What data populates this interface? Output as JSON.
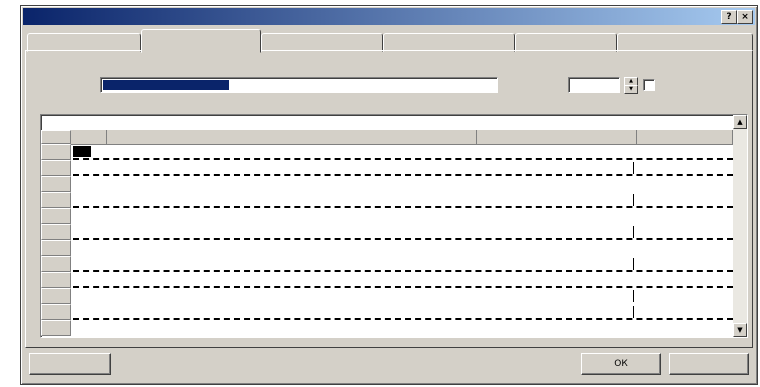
{
  "dialog": {
    "title": "",
    "help_glyph": "?",
    "close_glyph": "×"
  },
  "tabs": [
    {
      "label": ""
    },
    {
      "label": ""
    },
    {
      "label": ""
    },
    {
      "label": ""
    },
    {
      "label": ""
    },
    {
      "label": ""
    }
  ],
  "form": {
    "name_label": "",
    "name_value": "",
    "priority_label": "",
    "priority_value": "",
    "checkbox_label": "",
    "predecessors_label": ""
  },
  "grid": {
    "columns": [
      "",
      "",
      "",
      ""
    ]
  },
  "buttons": {
    "help": "",
    "ok": "ОК",
    "cancel": ""
  }
}
